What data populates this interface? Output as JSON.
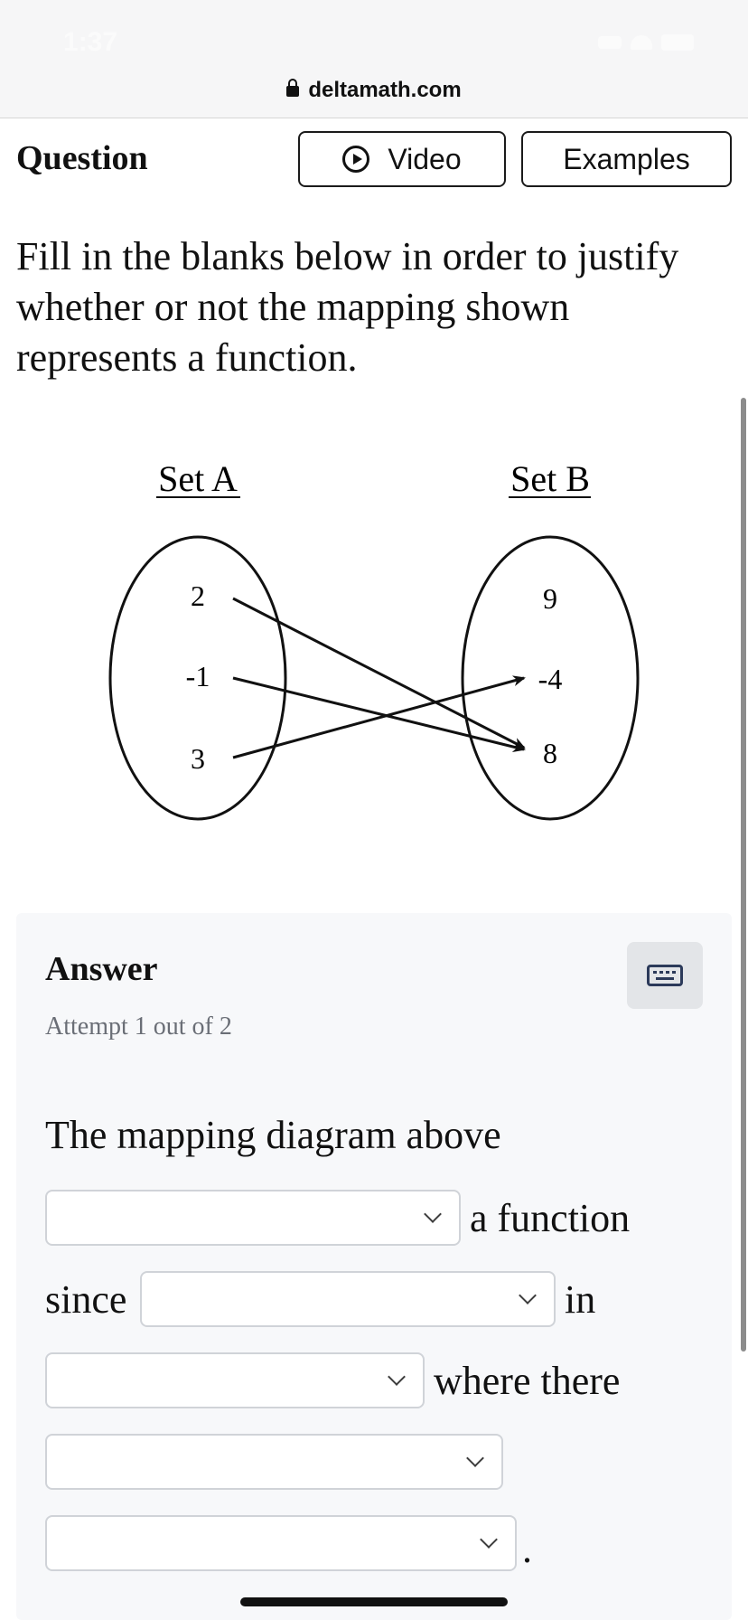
{
  "status": {
    "time": "1:37"
  },
  "browser": {
    "url": "deltamath.com"
  },
  "header": {
    "title": "Question",
    "video_label": "Video",
    "examples_label": "Examples"
  },
  "prompt": "Fill in the blanks below in order to justify whether or not the mapping shown represents a function.",
  "diagram": {
    "set_a_label": "Set A",
    "set_b_label": "Set B",
    "set_a": [
      "2",
      "-1",
      "3"
    ],
    "set_b": [
      "9",
      "-4",
      "8"
    ],
    "mappings": [
      [
        "2",
        "8"
      ],
      [
        "-1",
        "8"
      ],
      [
        "3",
        "-4"
      ]
    ]
  },
  "answer": {
    "title": "Answer",
    "attempt": "Attempt 1 out of 2",
    "statement": "The mapping diagram above",
    "words": {
      "a_function": "a function",
      "since": "since",
      "in": "in",
      "where_there": "where there",
      "period": "."
    },
    "dropdowns": [
      "",
      "",
      "",
      "",
      ""
    ]
  },
  "icons": [
    "lock-icon",
    "play-circle-icon",
    "keyboard-icon",
    "chevron-down-icon"
  ]
}
